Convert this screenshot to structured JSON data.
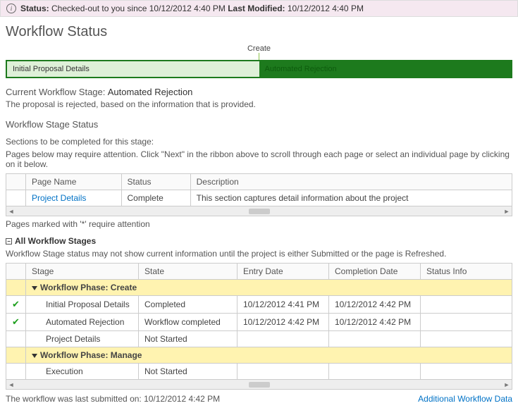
{
  "statusBar": {
    "statusLabel": "Status:",
    "statusText": "Checked-out to you since 10/12/2012 4:40 PM",
    "lastModLabel": "Last Modified:",
    "lastModText": "10/12/2012 4:40 PM"
  },
  "pageTitle": "Workflow Status",
  "createLabel": "Create",
  "phases": {
    "left": "Initial Proposal Details",
    "right": "Automated Rejection"
  },
  "currentStage": {
    "label": "Current Workflow Stage:",
    "name": "Automated Rejection",
    "desc": "The proposal is rejected, based on the information that is provided."
  },
  "stageStatusHeader": "Workflow Stage Status",
  "sectionsHeader": "Sections to be completed for this stage:",
  "sectionsNote": "Pages below may require attention. Click \"Next\" in the ribbon above to scroll through each page or select an individual page by clicking on it below.",
  "pagesTable": {
    "headers": [
      "Page Name",
      "Status",
      "Description"
    ],
    "rows": [
      {
        "name": "Project Details",
        "status": "Complete",
        "desc": "This section captures detail information about the project"
      }
    ]
  },
  "attentionNote": "Pages marked with '*' require attention",
  "allStagesHeader": "All Workflow Stages",
  "stageNote": "Workflow Stage status may not show current information until the project is either Submitted or the page is Refreshed.",
  "stageTable": {
    "headers": [
      "Stage",
      "State",
      "Entry Date",
      "Completion Date",
      "Status Info"
    ],
    "rows": [
      {
        "type": "phase",
        "label": "Workflow Phase: Create"
      },
      {
        "type": "stage",
        "check": true,
        "stage": "Initial Proposal Details",
        "state": "Completed",
        "entry": "10/12/2012 4:41 PM",
        "completion": "10/12/2012 4:42 PM",
        "info": ""
      },
      {
        "type": "stage",
        "check": true,
        "stage": "Automated Rejection",
        "state": "Workflow completed",
        "entry": "10/12/2012 4:42 PM",
        "completion": "10/12/2012 4:42 PM",
        "info": ""
      },
      {
        "type": "stage",
        "check": false,
        "stage": "Project Details",
        "state": "Not Started",
        "entry": "",
        "completion": "",
        "info": ""
      },
      {
        "type": "phase",
        "label": "Workflow Phase: Manage"
      },
      {
        "type": "stage",
        "check": false,
        "stage": "Execution",
        "state": "Not Started",
        "entry": "",
        "completion": "",
        "info": ""
      }
    ]
  },
  "footer": {
    "submitted": "The workflow was last submitted on: 10/12/2012 4:42 PM",
    "link": "Additional Workflow Data"
  }
}
